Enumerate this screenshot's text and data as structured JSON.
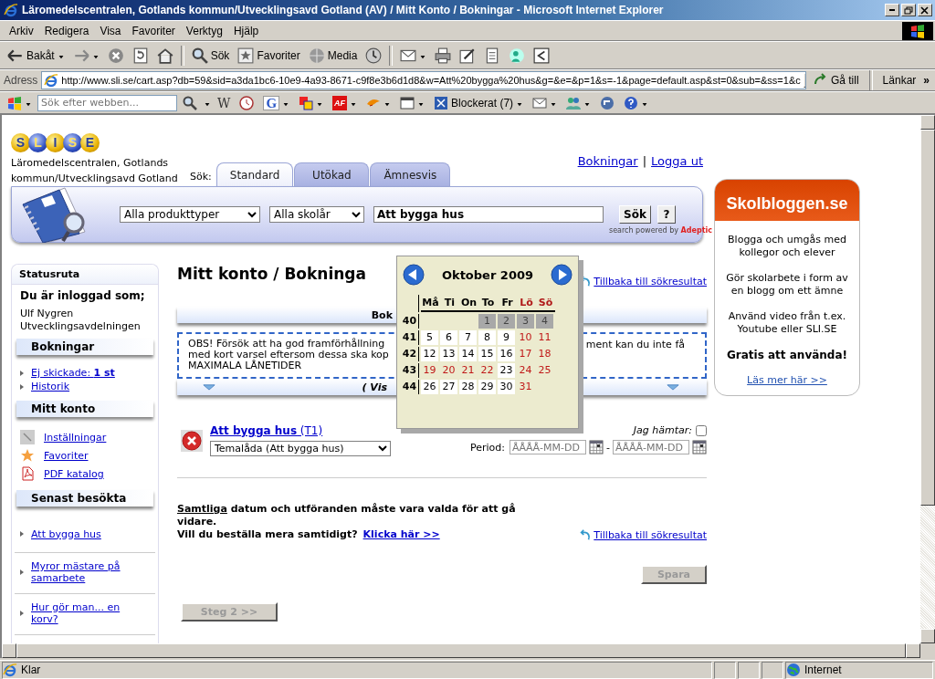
{
  "window": {
    "title": "Läromedelscentralen, Gotlands kommun/Utvecklingsavd Gotland (AV) / Mitt Konto / Bokningar - Microsoft Internet Explorer"
  },
  "menu": [
    "Arkiv",
    "Redigera",
    "Visa",
    "Favoriter",
    "Verktyg",
    "Hjälp"
  ],
  "toolbar": [
    {
      "kind": "back",
      "label": "Bakåt",
      "dropdown": true
    },
    {
      "kind": "forward",
      "dropdown": true
    },
    {
      "kind": "stop"
    },
    {
      "kind": "refresh"
    },
    {
      "kind": "home"
    },
    {
      "kind": "separator"
    },
    {
      "kind": "search",
      "label": "Sök"
    },
    {
      "kind": "favorites",
      "label": "Favoriter"
    },
    {
      "kind": "media",
      "label": "Media"
    },
    {
      "kind": "history"
    },
    {
      "kind": "separator"
    },
    {
      "kind": "mail",
      "dropdown": true
    },
    {
      "kind": "print"
    },
    {
      "kind": "edit"
    },
    {
      "kind": "discuss"
    },
    {
      "kind": "messenger"
    },
    {
      "kind": "research"
    }
  ],
  "address": {
    "label": "Adress",
    "url": "http://www.sli.se/cart.asp?db=59&sid=a3da1bc6-10e9-4a93-8671-c9f8e3b6d1d8&w=Att%20bygga%20hus&g=&e=&p=1&s=-1&page=default.asp&st=0&sub=&ss=1&c",
    "go": "Gå till",
    "links": "Länkar",
    "more": "»"
  },
  "searchbar": {
    "placeholder": "Sök efter webben...",
    "items": [
      {
        "kind": "serif-letter",
        "glyph": "W"
      },
      {
        "kind": "clock"
      },
      {
        "kind": "google-letter",
        "glyph": "G",
        "dropdown": true
      },
      {
        "kind": "squares",
        "dropdown": true
      },
      {
        "kind": "badge-letter",
        "glyph": "AF",
        "dropdown": true
      },
      {
        "kind": "bird",
        "dropdown": true
      },
      {
        "kind": "window",
        "dropdown": true
      },
      {
        "kind": "blocked",
        "label": "Blockerat (7)",
        "dropdown": true
      },
      {
        "kind": "mail",
        "dropdown": true
      },
      {
        "kind": "people",
        "dropdown": true
      },
      {
        "kind": "circle-arrow"
      },
      {
        "kind": "help",
        "dropdown": true
      }
    ]
  },
  "header": {
    "logo": [
      "S",
      "L",
      "I",
      "S",
      "E"
    ],
    "site_name": "Läromedelscentralen, Gotlands kommun/Utvecklingsavd Gotland",
    "search_label": "Sök:",
    "tabs": [
      {
        "label": "Standard",
        "selected": true
      },
      {
        "label": "Utökad",
        "selected": false
      },
      {
        "label": "Ämnesvis",
        "selected": false
      }
    ],
    "user_links": [
      "Bokningar",
      "Logga ut"
    ],
    "link_separator": "|"
  },
  "search": {
    "product_type": "Alla produkttyper",
    "grade": "Alla skolår",
    "query": "Att bygga hus",
    "button": "Sök",
    "help": "?",
    "powered_by": "search powered by",
    "brand": "Adeptic"
  },
  "sidebar": {
    "title": "Statusruta",
    "logged_in_label": "Du är inloggad som;",
    "user": [
      "Ulf Nygren",
      "Utvecklingsavdelningen"
    ],
    "sections": [
      {
        "title": "Bokningar",
        "kind": "bullets",
        "items": [
          {
            "label": "Ej skickade: **1 st**"
          },
          {
            "label": "Historik"
          }
        ]
      },
      {
        "title": "Mitt konto",
        "kind": "icons",
        "items": [
          {
            "label": "Inställningar",
            "kind": "wrench"
          },
          {
            "label": "Favoriter",
            "kind": "star"
          },
          {
            "label": "PDF katalog",
            "kind": "pdf"
          }
        ]
      },
      {
        "title": "Senast besökta",
        "kind": "divided",
        "items": [
          {
            "label": "Att bygga hus"
          },
          {
            "label": "Myror mästare på samarbete"
          },
          {
            "label": "Hur gör man... en korv?"
          }
        ]
      }
    ]
  },
  "main": {
    "heading": "Mitt konto / Bokninga",
    "back_link": "Tillbaka till sökresultat",
    "panel_title": "Bok",
    "notice_lines": [
      "OBS! Försök att ha god framförhållning",
      "med kort varsel eftersom dessa ska kop",
      "MAXIMALA LÅNETIDER"
    ],
    "notice_right": "ment kan du inte få",
    "panel_footer": "( Vis",
    "booking": {
      "title": "**Att bygga hus** (T1)",
      "package": "Temalåda (Att bygga hus)",
      "pickup_label": "Jag hämtar:",
      "pickup_checked": false,
      "period_label": "Period:",
      "from_placeholder": "ÅÅÅÅ-MM-DD",
      "separator": "-",
      "to_placeholder": "ÅÅÅÅ-MM-DD"
    },
    "requirement": {
      "emphasis": "Samtliga",
      "rest": " datum och utföranden måste vara valda för att gå vidare."
    },
    "question": "Vill du beställa mera samtidigt?",
    "question_link": "Klicka här >>",
    "back_link_bottom": "Tillbaka till sökresultat",
    "save": {
      "label": "Spara",
      "disabled": true
    },
    "next": {
      "label": "Steg 2 >>",
      "disabled": true
    }
  },
  "calendar": {
    "title": "Oktober 2009",
    "weekdays": [
      {
        "label": "Må",
        "weekend": false
      },
      {
        "label": "Ti",
        "weekend": false
      },
      {
        "label": "On",
        "weekend": false
      },
      {
        "label": "To",
        "weekend": false
      },
      {
        "label": "Fr",
        "weekend": false
      },
      {
        "label": "Lö",
        "weekend": true
      },
      {
        "label": "Sö",
        "weekend": true
      }
    ],
    "weeks": [
      {
        "number": "40",
        "days": [
          {
            "day": "1",
            "kind": "past"
          },
          {
            "day": "2",
            "kind": "past"
          },
          {
            "day": "3",
            "kind": "past"
          },
          {
            "day": "4",
            "kind": "past"
          }
        ]
      },
      {
        "number": "41",
        "days": [
          {
            "day": "5",
            "kind": "open"
          },
          {
            "day": "6",
            "kind": "open"
          },
          {
            "day": "7",
            "kind": "open"
          },
          {
            "day": "8",
            "kind": "open"
          },
          {
            "day": "9",
            "kind": "open"
          },
          {
            "day": "10",
            "kind": "closed"
          },
          {
            "day": "11",
            "kind": "closed"
          }
        ]
      },
      {
        "number": "42",
        "days": [
          {
            "day": "12",
            "kind": "open"
          },
          {
            "day": "13",
            "kind": "open"
          },
          {
            "day": "14",
            "kind": "open"
          },
          {
            "day": "15",
            "kind": "open"
          },
          {
            "day": "16",
            "kind": "open"
          },
          {
            "day": "17",
            "kind": "closed"
          },
          {
            "day": "18",
            "kind": "closed"
          }
        ]
      },
      {
        "number": "43",
        "days": [
          {
            "day": "19",
            "kind": "closed"
          },
          {
            "day": "20",
            "kind": "closed"
          },
          {
            "day": "21",
            "kind": "closed"
          },
          {
            "day": "22",
            "kind": "closed"
          },
          {
            "day": "23",
            "kind": "open"
          },
          {
            "day": "24",
            "kind": "closed"
          },
          {
            "day": "25",
            "kind": "closed"
          }
        ]
      },
      {
        "number": "44",
        "days": [
          {
            "day": "26",
            "kind": "open"
          },
          {
            "day": "27",
            "kind": "open"
          },
          {
            "day": "28",
            "kind": "open"
          },
          {
            "day": "29",
            "kind": "open"
          },
          {
            "day": "30",
            "kind": "open"
          },
          {
            "day": "31",
            "kind": "closed"
          }
        ]
      }
    ]
  },
  "ad": {
    "title": "Skolbloggen.se",
    "paragraphs": [
      {
        "text": "Blogga och umgås med kollegor och elever",
        "kind": "plain"
      },
      {
        "text": "Gör skolarbete i form av en blogg om ett ämne",
        "kind": "plain"
      },
      {
        "text": "Använd video från t.ex. Youtube eller SLI.SE",
        "kind": "plain"
      },
      {
        "text": "Gratis att använda!",
        "kind": "bold"
      }
    ],
    "link": "Läs mer här >>"
  },
  "status_bar": {
    "text": "Klar",
    "zone": "Internet"
  }
}
